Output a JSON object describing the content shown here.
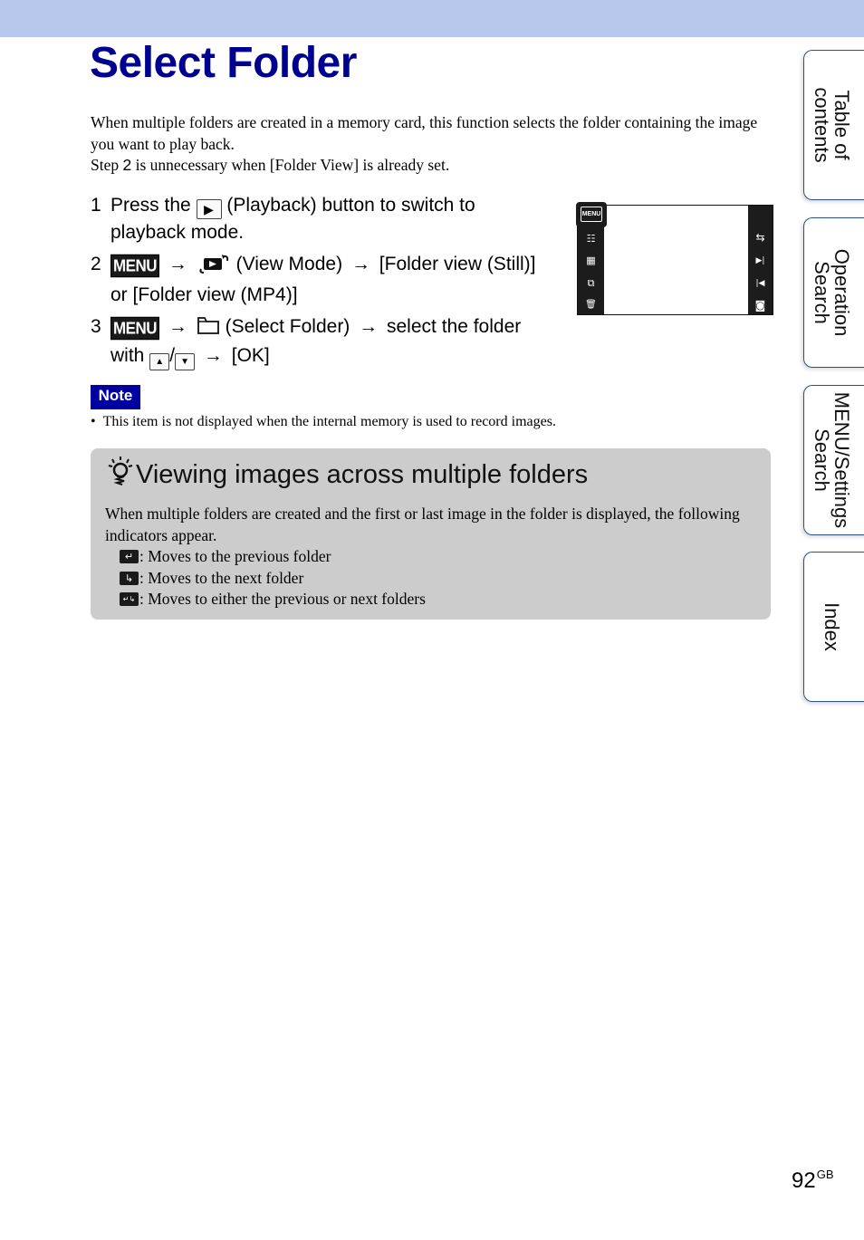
{
  "header": {
    "band_color": "#b8c7ec",
    "title": "Select Folder",
    "title_color": "#00008f"
  },
  "intro": {
    "line1": "When multiple folders are created in a memory card, this function selects the folder containing the image you want to play back.",
    "line2_pre": "Step ",
    "line2_num": "2",
    "line2_post": " is unnecessary when [Folder View] is already set."
  },
  "steps": [
    {
      "num": "1",
      "pre": "Press the",
      "icon": "playback-button-icon",
      "post": "(Playback) button to switch to playback mode."
    },
    {
      "num": "2",
      "menu": "MENU",
      "arrow": "→",
      "icon": "view-mode-icon",
      "post": "(View Mode)",
      "post2": "[Folder view (Still)] or [Folder view (MP4)]"
    },
    {
      "num": "3",
      "menu": "MENU",
      "arrow": "→",
      "icon": "folder-icon",
      "post": "(Select Folder)",
      "post2": "select the folder with",
      "up": "▲",
      "sep": "/",
      "down": "▼",
      "post3": "[OK]"
    }
  ],
  "screen": {
    "menu_label": "MENU",
    "left_icons": [
      "list-icon",
      "grid-icon",
      "slideshow-icon",
      "trash-icon"
    ],
    "left_glyphs": [
      "☷",
      "▦",
      "⧉",
      "🗑"
    ],
    "right_icons": [
      "scroll-arrows-icon",
      "next-icon",
      "previous-icon",
      "camera-icon"
    ],
    "right_glyphs": [
      "⇆",
      "▶|",
      "|◀",
      "◙"
    ]
  },
  "note": {
    "label": "Note",
    "label_color": "#0000a0",
    "bullet": "•",
    "text": "This item is not displayed when the internal memory is used to record images."
  },
  "tip": {
    "title": "Viewing images across multiple folders",
    "body": "When multiple folders are created and the first or last image in the folder is displayed, the following indicators appear.",
    "indicators": [
      {
        "icon": "previous-folder-icon",
        "glyph": "↵",
        "text": ": Moves to the previous folder"
      },
      {
        "icon": "next-folder-icon",
        "glyph": "↳",
        "text": ": Moves to the next folder"
      },
      {
        "icon": "either-folder-icon",
        "glyph": "↵↳",
        "text": ": Moves to either the previous or next folders"
      }
    ]
  },
  "side_tabs": [
    {
      "label": "Table of\ncontents",
      "line1": "Table of",
      "line2": "contents"
    },
    {
      "label": "Operation\nSearch",
      "line1": "Operation",
      "line2": "Search"
    },
    {
      "label": "MENU/Settings\nSearch",
      "line1": "MENU/Settings",
      "line2": "Search"
    },
    {
      "label": "Index",
      "line1": "Index",
      "line2": ""
    }
  ],
  "footer": {
    "page": "92",
    "suffix": "GB"
  }
}
